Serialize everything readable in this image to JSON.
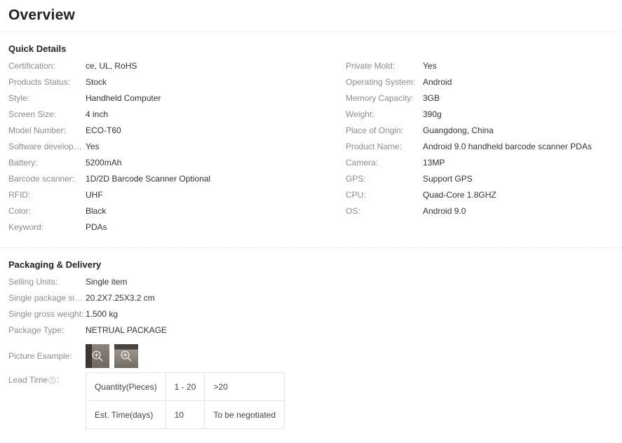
{
  "page": {
    "title": "Overview"
  },
  "quick_details": {
    "heading": "Quick Details",
    "left": [
      {
        "label": "Certification:",
        "value": "ce, UL, RoHS"
      },
      {
        "label": "Products Status:",
        "value": "Stock"
      },
      {
        "label": "Style:",
        "value": "Handheld Computer"
      },
      {
        "label": "Screen Size:",
        "value": "4 inch"
      },
      {
        "label": "Model Number:",
        "value": "ECO-T60"
      },
      {
        "label": "Software developm...",
        "value": "Yes"
      },
      {
        "label": "Battery:",
        "value": "5200mAh"
      },
      {
        "label": "Barcode scanner:",
        "value": "1D/2D Barcode Scanner Optional"
      },
      {
        "label": "RFID:",
        "value": "UHF"
      },
      {
        "label": "Color:",
        "value": "Black"
      },
      {
        "label": "Keyword:",
        "value": "PDAs"
      }
    ],
    "right": [
      {
        "label": "Private Mold:",
        "value": "Yes"
      },
      {
        "label": "Operating System:",
        "value": "Android"
      },
      {
        "label": "Memory Capacity:",
        "value": "3GB"
      },
      {
        "label": "Weight:",
        "value": "390g"
      },
      {
        "label": "Place of Origin:",
        "value": "Guangdong, China"
      },
      {
        "label": "Product Name:",
        "value": "Android 9.0 handheld barcode scanner PDAs"
      },
      {
        "label": "Camera:",
        "value": "13MP"
      },
      {
        "label": "GPS:",
        "value": "Support GPS"
      },
      {
        "label": "CPU:",
        "value": "Quad-Core 1.8GHZ"
      },
      {
        "label": "OS:",
        "value": "Android 9.0"
      }
    ]
  },
  "packaging": {
    "heading": "Packaging & Delivery",
    "rows": [
      {
        "label": "Selling Units:",
        "value": "Single item"
      },
      {
        "label": "Single package size:",
        "value": "20.2X7.25X3.2 cm"
      },
      {
        "label": "Single gross weight:",
        "value": "1.500 kg"
      },
      {
        "label": "Package Type:",
        "value": "NETRUAL PACKAGE"
      }
    ],
    "picture_example": {
      "label": "Picture Example:",
      "thumbs": [
        {
          "name": "picture-example-thumb-1",
          "icon": "zoom-in-icon"
        },
        {
          "name": "picture-example-thumb-2",
          "icon": "zoom-in-icon"
        }
      ]
    },
    "lead_time": {
      "label_prefix": "Lead Time",
      "label_suffix": ":",
      "help_icon": "question-mark-circle-icon",
      "table": {
        "rows": [
          {
            "header": "Quantity(Pieces)",
            "cells": [
              "1 - 20",
              ">20"
            ]
          },
          {
            "header": "Est. Time(days)",
            "cells": [
              "10",
              "To be negotiated"
            ]
          }
        ]
      }
    }
  },
  "colors": {
    "label_gray": "#8c8c8c",
    "value_dark": "#333333",
    "rule": "#ececec",
    "table_border": "#e6e6e6"
  }
}
